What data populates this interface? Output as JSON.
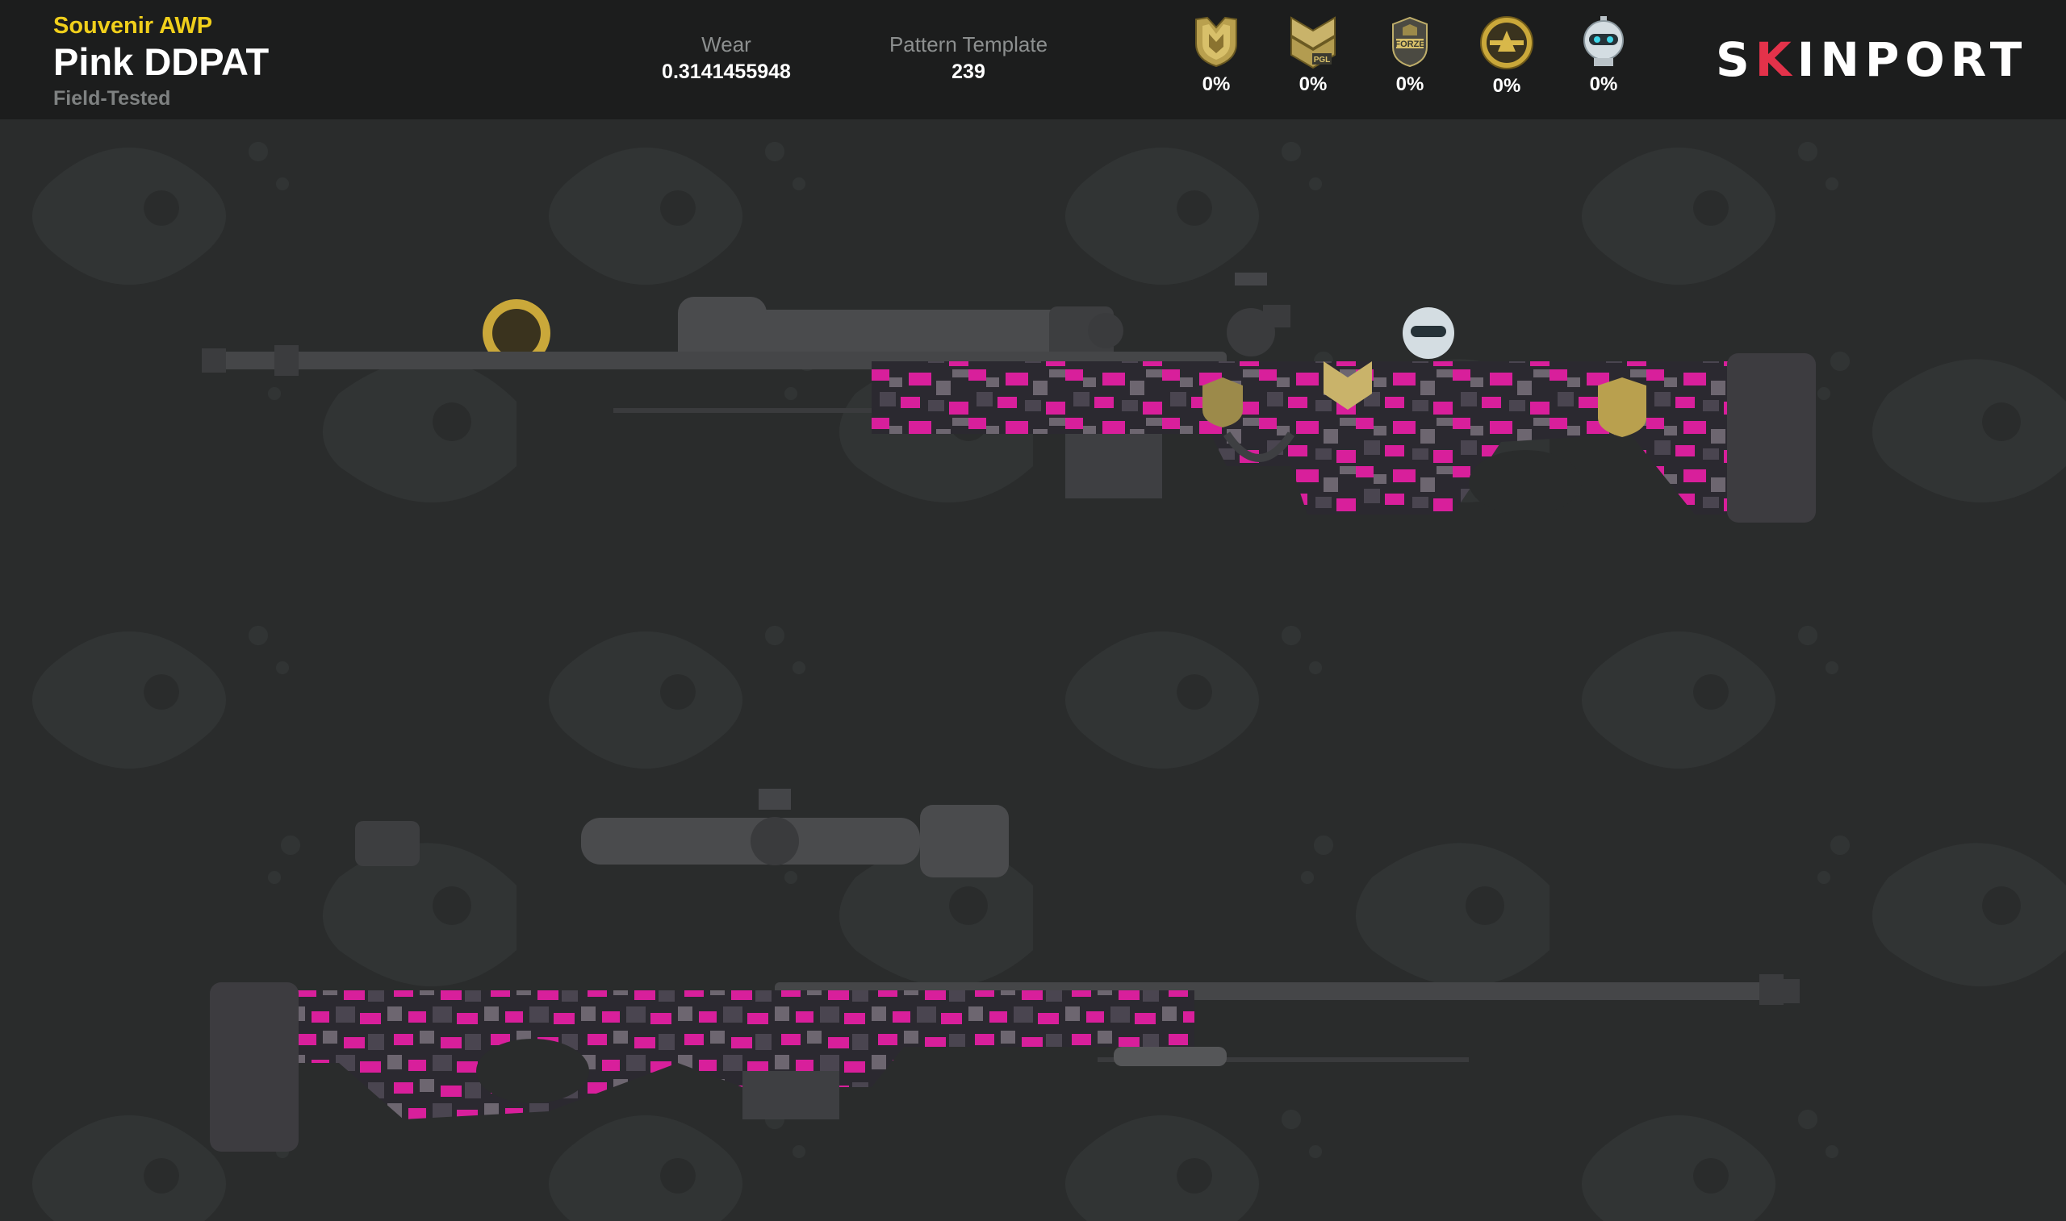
{
  "item": {
    "subtitle": "Souvenir AWP",
    "name": "Pink DDPAT",
    "exterior": "Field-Tested"
  },
  "stats": {
    "wear_label": "Wear",
    "wear_value": "0.3141455948",
    "pattern_label": "Pattern Template",
    "pattern_value": "239"
  },
  "stickers": [
    {
      "icon": "team-shield-sticker-icon",
      "wear": "0%"
    },
    {
      "icon": "pgl-chevron-sticker-icon",
      "wear": "0%"
    },
    {
      "icon": "forze-sticker-icon",
      "wear": "0%"
    },
    {
      "icon": "gold-coin-sticker-icon",
      "wear": "0%"
    },
    {
      "icon": "robot-sticker-icon",
      "wear": "0%"
    }
  ],
  "brand": {
    "logo_text": "SKINPORT",
    "accent_color": "#e3324a"
  },
  "colors": {
    "header_bg": "#1c1d1d",
    "page_bg": "#2a2c2c",
    "subtitle": "#f0cf1b",
    "camo_pink": "#d81f9b",
    "camo_dark": "#2b2930",
    "camo_gray": "#6d6670"
  }
}
